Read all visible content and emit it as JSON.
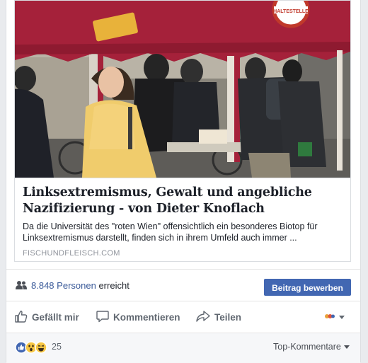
{
  "link_preview": {
    "image_alt": "Passantin vor einem roten Infostand-Zelt",
    "sign_text": "HALTESTELLE",
    "title": "Linksextremismus, Gewalt und angebliche Nazifizierung - von Dieter Knoflach",
    "description": "Da die Universität des \"roten Wien\" offensichtlich ein besonderes Biotop für Linksextremismus darstellt, finden sich in ihrem Umfeld auch immer ...",
    "domain": "FISCHUNDFLEISCH.COM"
  },
  "reach": {
    "count": "8.848",
    "people_word": "Personen",
    "suffix": "erreicht",
    "icon": "people-icon"
  },
  "boost_button": {
    "label": "Beitrag bewerben",
    "color": "#4267b2"
  },
  "actions": {
    "like": {
      "label": "Gefällt mir",
      "icon": "thumbs-up-icon"
    },
    "comment": {
      "label": "Kommentieren",
      "icon": "comment-bubble-icon"
    },
    "share": {
      "label": "Teilen",
      "icon": "share-arrow-icon"
    },
    "emoji_picker_icon": "emoji-menu-icon"
  },
  "reactions": {
    "icons": [
      "like-reaction-icon",
      "wow-reaction-icon",
      "haha-reaction-icon"
    ],
    "count": "25",
    "sort_label": "Top-Kommentare"
  },
  "colors": {
    "link_blue": "#385898",
    "action_grey": "#606770",
    "tent_red": "#a5213a"
  }
}
